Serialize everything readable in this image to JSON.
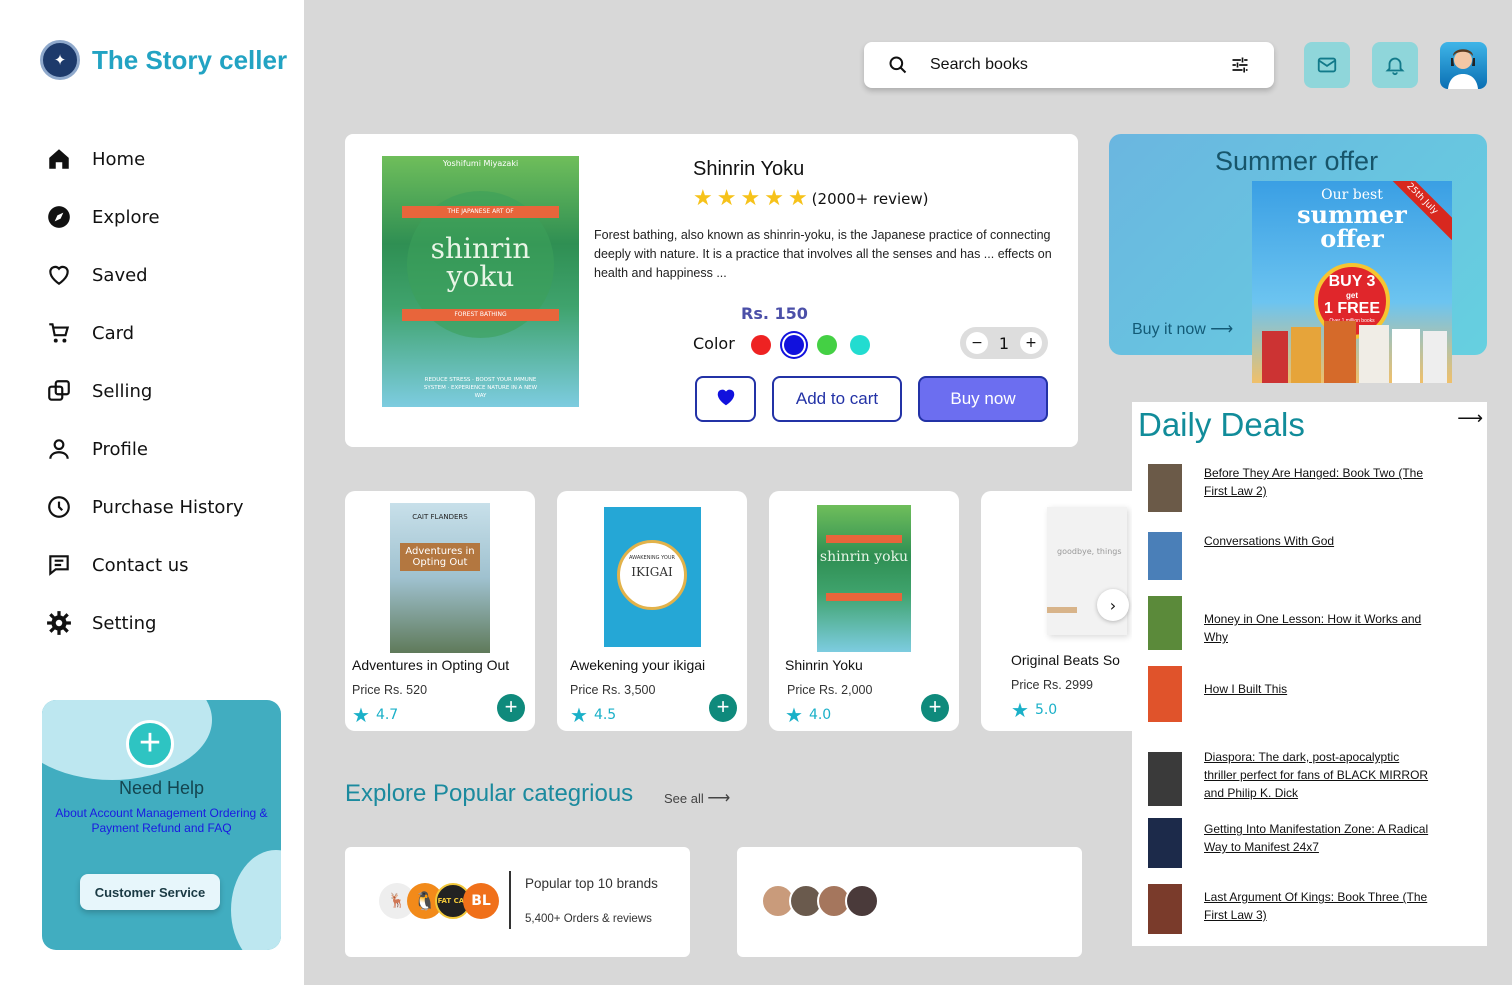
{
  "brand": {
    "name": "The Story celler"
  },
  "nav": [
    {
      "label": "Home"
    },
    {
      "label": "Explore"
    },
    {
      "label": "Saved"
    },
    {
      "label": "Card"
    },
    {
      "label": "Selling"
    },
    {
      "label": "Profile"
    },
    {
      "label": "Purchase History"
    },
    {
      "label": "Contact us"
    },
    {
      "label": "Setting"
    }
  ],
  "help": {
    "title": "Need Help",
    "desc": "About Account Management Ordering & Payment Refund and FAQ",
    "button": "Customer Service"
  },
  "search": {
    "placeholder": "Search books"
  },
  "feature": {
    "cover": {
      "author": "Yoshifumi Miyazaki",
      "ribbon_top": "THE JAPANESE ART OF",
      "title_line1": "shinrin",
      "title_line2": "yoku",
      "ribbon_bottom": "FOREST BATHING",
      "tagline": "REDUCE STRESS · BOOST YOUR IMMUNE SYSTEM · EXPERIENCE NATURE IN A NEW WAY"
    },
    "title": "Shinrin Yoku",
    "rating_stars": 5,
    "reviews": "(2000+ review)",
    "description": "Forest bathing, also known as shinrin-yoku, is the Japanese practice of connecting deeply with nature. It is a practice that involves all the senses and has ... effects on health and happiness ...",
    "price": "Rs. 150",
    "color_label": "Color",
    "colors": [
      "#ee2222",
      "#1111dd",
      "#44d044",
      "#22dcd0"
    ],
    "selected_color": 1,
    "quantity": "1",
    "add_to_cart": "Add to cart",
    "buy_now": "Buy now"
  },
  "books": [
    {
      "name": "Adventures in Opting Out",
      "price": "Price Rs. 520",
      "rating": "4.7",
      "cover_title": "Adventures in Opting Out",
      "cover_author": "CAIT FLANDERS"
    },
    {
      "name": "Awekening your ikigai",
      "price": "Price Rs. 3,500",
      "rating": "4.5",
      "cover_title": "IKIGAI",
      "cover_top": "AWAKENING YOUR"
    },
    {
      "name": "Shinrin Yoku",
      "price": "Price Rs. 2,000",
      "rating": "4.0",
      "cover_title": "shinrin yoku"
    },
    {
      "name": "Original Beats So",
      "price": "Price Rs. 2999",
      "rating": "5.0",
      "cover_title": "goodbye, things"
    }
  ],
  "categories": {
    "title": "Explore Popular categrious",
    "see_all": "See all",
    "brands_title": "Popular top 10 brands",
    "brands_sub": "5,400+ Orders & reviews",
    "brand_logo_text": "FAT CAT"
  },
  "offer": {
    "title": "Summer offer",
    "link": "Buy it now",
    "poster_line1": "Our best",
    "poster_line2": "summer",
    "poster_line3": "offer",
    "poster_badge1": "BUY 3",
    "poster_badge_mid": "get",
    "poster_badge2": "1 FREE",
    "poster_badge_sub": "Over 1 million books",
    "poster_corner": "25th July"
  },
  "deals": {
    "title": "Daily Deals",
    "items": [
      {
        "title": "Before They Are Hanged: Book Two (The First Law 2)",
        "color": "#6b5a48"
      },
      {
        "title": "Conversations With God",
        "color": "#4a7fb8"
      },
      {
        "title": "Money in One Lesson: How it Works and Why",
        "color": "#5b8a3a"
      },
      {
        "title": "How I Built This",
        "color": "#e0532b"
      },
      {
        "title": "Diaspora: The dark, post-apocalyptic thriller perfect for fans of BLACK MIRROR and Philip K. Dick",
        "color": "#3a3a3a"
      },
      {
        "title": "Getting Into Manifestation Zone: A Radical Way to Manifest 24x7",
        "color": "#1c2a4a"
      },
      {
        "title": "Last Argument Of Kings: Book Three (The First Law 3)",
        "color": "#7a3b2b"
      }
    ]
  }
}
